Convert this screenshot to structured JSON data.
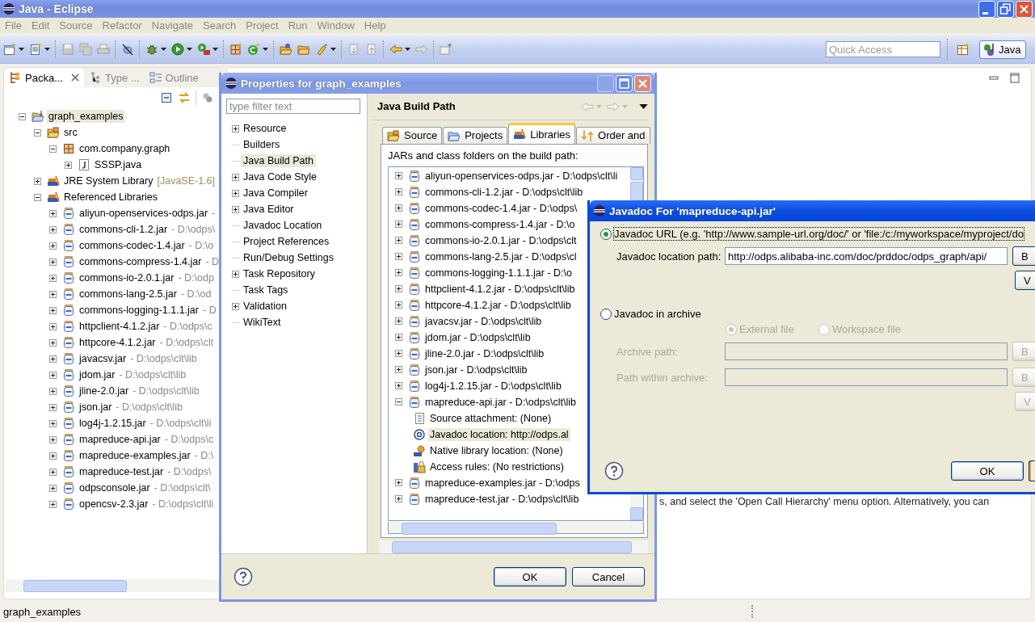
{
  "window": {
    "title": "Java - Eclipse"
  },
  "menu": [
    "File",
    "Edit",
    "Source",
    "Refactor",
    "Navigate",
    "Search",
    "Project",
    "Run",
    "Window",
    "Help"
  ],
  "quick_access": {
    "placeholder": "Quick Access"
  },
  "perspective": {
    "label": "Java",
    "selected": true
  },
  "view_tabs": [
    {
      "label": "Packa...",
      "selected": true
    },
    {
      "label": "Type ...",
      "selected": false
    },
    {
      "label": "Outline",
      "selected": false
    }
  ],
  "package_tree": [
    {
      "label": "graph_examples",
      "kind": "project",
      "expanded": true,
      "selected": true,
      "children": [
        {
          "label": "src",
          "kind": "source-folder",
          "expanded": true,
          "selected": false,
          "children": [
            {
              "label": "com.company.graph",
              "kind": "package",
              "expanded": true,
              "selected": false,
              "children": [
                {
                  "label": "SSSP.java",
                  "kind": "java-file",
                  "expanded": false,
                  "selected": false
                }
              ]
            }
          ]
        },
        {
          "label": "JRE System Library",
          "decoration": "[JavaSE-1.6]",
          "kind": "library",
          "expanded": false,
          "selected": false
        },
        {
          "label": "Referenced Libraries",
          "kind": "library",
          "expanded": true,
          "selected": false,
          "children": [
            {
              "label": "aliyun-openservices-odps.jar",
              "decoration": "-",
              "kind": "jar",
              "expanded": false,
              "selected": false
            },
            {
              "label": "commons-cli-1.2.jar",
              "decoration": "- D:\\odps\\",
              "kind": "jar",
              "expanded": false,
              "selected": false
            },
            {
              "label": "commons-codec-1.4.jar",
              "decoration": "- D:\\o",
              "kind": "jar",
              "expanded": false,
              "selected": false
            },
            {
              "label": "commons-compress-1.4.jar",
              "decoration": "- D",
              "kind": "jar",
              "expanded": false,
              "selected": false
            },
            {
              "label": "commons-io-2.0.1.jar",
              "decoration": "- D:\\odp",
              "kind": "jar",
              "expanded": false,
              "selected": false
            },
            {
              "label": "commons-lang-2.5.jar",
              "decoration": "- D:\\od",
              "kind": "jar",
              "expanded": false,
              "selected": false
            },
            {
              "label": "commons-logging-1.1.1.jar",
              "decoration": "- D",
              "kind": "jar",
              "expanded": false,
              "selected": false
            },
            {
              "label": "httpclient-4.1.2.jar",
              "decoration": "- D:\\odps\\c",
              "kind": "jar",
              "expanded": false,
              "selected": false
            },
            {
              "label": "httpcore-4.1.2.jar",
              "decoration": "- D:\\odps\\clt",
              "kind": "jar",
              "expanded": false,
              "selected": false
            },
            {
              "label": "javacsv.jar",
              "decoration": "- D:\\odps\\clt\\lib",
              "kind": "jar",
              "expanded": false,
              "selected": false
            },
            {
              "label": "jdom.jar",
              "decoration": "- D:\\odps\\clt\\lib",
              "kind": "jar",
              "expanded": false,
              "selected": false
            },
            {
              "label": "jline-2.0.jar",
              "decoration": "- D:\\odps\\clt\\lib",
              "kind": "jar",
              "expanded": false,
              "selected": false
            },
            {
              "label": "json.jar",
              "decoration": "- D:\\odps\\clt\\lib",
              "kind": "jar",
              "expanded": false,
              "selected": false
            },
            {
              "label": "log4j-1.2.15.jar",
              "decoration": "- D:\\odps\\clt\\li",
              "kind": "jar",
              "expanded": false,
              "selected": false
            },
            {
              "label": "mapreduce-api.jar",
              "decoration": "- D:\\odps\\c",
              "kind": "jar",
              "expanded": false,
              "selected": false
            },
            {
              "label": "mapreduce-examples.jar",
              "decoration": "- D:\\",
              "kind": "jar",
              "expanded": false,
              "selected": false
            },
            {
              "label": "mapreduce-test.jar",
              "decoration": "- D:\\odps\\",
              "kind": "jar",
              "expanded": false,
              "selected": false
            },
            {
              "label": "odpsconsole.jar",
              "decoration": "- D:\\odps\\clt\\",
              "kind": "jar",
              "expanded": false,
              "selected": false
            },
            {
              "label": "opencsv-2.3.jar",
              "decoration": "- D:\\odps\\clt\\li",
              "kind": "jar",
              "expanded": false,
              "selected": false
            }
          ]
        }
      ]
    }
  ],
  "editor": {
    "text": "s, and select the 'Open Call Hierarchy' menu option. Alternatively, you can"
  },
  "status_bar": {
    "text": "graph_examples"
  },
  "properties_dialog": {
    "title": "Properties for graph_examples",
    "filter": {
      "placeholder": "type filter text"
    },
    "categories": [
      {
        "label": "Resource",
        "expandable": true,
        "selected": false
      },
      {
        "label": "Builders",
        "expandable": false,
        "selected": false
      },
      {
        "label": "Java Build Path",
        "expandable": false,
        "selected": true
      },
      {
        "label": "Java Code Style",
        "expandable": true,
        "selected": false
      },
      {
        "label": "Java Compiler",
        "expandable": true,
        "selected": false
      },
      {
        "label": "Java Editor",
        "expandable": true,
        "selected": false
      },
      {
        "label": "Javadoc Location",
        "expandable": false,
        "selected": false
      },
      {
        "label": "Project References",
        "expandable": false,
        "selected": false
      },
      {
        "label": "Run/Debug Settings",
        "expandable": false,
        "selected": false
      },
      {
        "label": "Task Repository",
        "expandable": true,
        "selected": false
      },
      {
        "label": "Task Tags",
        "expandable": false,
        "selected": false
      },
      {
        "label": "Validation",
        "expandable": true,
        "selected": false
      },
      {
        "label": "WikiText",
        "expandable": false,
        "selected": false
      }
    ],
    "page_title": "Java Build Path",
    "tabs": [
      {
        "label": "Source",
        "kind": "source",
        "selected": false
      },
      {
        "label": "Projects",
        "kind": "projects",
        "selected": false
      },
      {
        "label": "Libraries",
        "kind": "libraries",
        "selected": true
      },
      {
        "label": "Order and",
        "kind": "order",
        "selected": false
      }
    ],
    "list_caption": "JARs and class folders on the build path:",
    "libraries": [
      {
        "name": "aliyun-openservices-odps.jar - D:\\odps\\clt\\li",
        "expanded": false,
        "selected": false
      },
      {
        "name": "commons-cli-1.2.jar - D:\\odps\\clt\\lib",
        "expanded": false,
        "selected": false
      },
      {
        "name": "commons-codec-1.4.jar - D:\\odps\\",
        "expanded": false,
        "selected": false
      },
      {
        "name": "commons-compress-1.4.jar - D:\\o",
        "expanded": false,
        "selected": false
      },
      {
        "name": "commons-io-2.0.1.jar - D:\\odps\\clt",
        "expanded": false,
        "selected": false
      },
      {
        "name": "commons-lang-2.5.jar - D:\\odps\\cl",
        "expanded": false,
        "selected": false
      },
      {
        "name": "commons-logging-1.1.1.jar - D:\\o",
        "expanded": false,
        "selected": false
      },
      {
        "name": "httpclient-4.1.2.jar - D:\\odps\\clt\\lib",
        "expanded": false,
        "selected": false
      },
      {
        "name": "httpcore-4.1.2.jar - D:\\odps\\clt\\lib",
        "expanded": false,
        "selected": false
      },
      {
        "name": "javacsv.jar - D:\\odps\\clt\\lib",
        "expanded": false,
        "selected": false
      },
      {
        "name": "jdom.jar - D:\\odps\\clt\\lib",
        "expanded": false,
        "selected": false
      },
      {
        "name": "jline-2.0.jar - D:\\odps\\clt\\lib",
        "expanded": false,
        "selected": false
      },
      {
        "name": "json.jar - D:\\odps\\clt\\lib",
        "expanded": false,
        "selected": false
      },
      {
        "name": "log4j-1.2.15.jar - D:\\odps\\clt\\lib",
        "expanded": false,
        "selected": false
      },
      {
        "name": "mapreduce-api.jar - D:\\odps\\clt\\lib",
        "expanded": true,
        "selected": false,
        "children": [
          {
            "label": "Source attachment: (None)",
            "kind": "source",
            "selected": false
          },
          {
            "label": "Javadoc location: http://odps.al",
            "kind": "javadoc",
            "selected": true
          },
          {
            "label": "Native library location: (None)",
            "kind": "native",
            "selected": false
          },
          {
            "label": "Access rules: (No restrictions)",
            "kind": "access",
            "selected": false
          }
        ]
      },
      {
        "name": "mapreduce-examples.jar - D:\\odps",
        "expanded": false,
        "selected": false
      },
      {
        "name": "mapreduce-test.jar - D:\\odps\\clt\\lib",
        "expanded": false,
        "selected": false
      }
    ],
    "buttons": [
      {
        "label": "OK",
        "default": true
      },
      {
        "label": "Cancel",
        "default": false
      }
    ]
  },
  "javadoc_dialog": {
    "title": "Javadoc For 'mapreduce-api.jar'",
    "url_option": {
      "label": "Javadoc URL (e.g. 'http://www.sample-url.org/doc/' or 'file:/c:/myworkspace/myproject/do",
      "selected": true
    },
    "location_label": "Javadoc location path:",
    "location_value": "http://odps.alibaba-inc.com/doc/prddoc/odps_graph/api/",
    "url_buttons": [
      {
        "label": "B",
        "disabled": false
      },
      {
        "label": "V",
        "disabled": false
      }
    ],
    "archive_option": {
      "label": "Javadoc in archive",
      "selected": false
    },
    "archive_kinds": [
      {
        "label": "External file",
        "selected": true,
        "disabled": true
      },
      {
        "label": "Workspace file",
        "selected": false,
        "disabled": true
      }
    ],
    "archive_fields": [
      {
        "label": "Archive path:",
        "disabled": true,
        "button": "B"
      },
      {
        "label": "Path within archive:",
        "disabled": true,
        "button": "B"
      }
    ],
    "archive_validate": {
      "label": "V",
      "disabled": true
    },
    "ok": {
      "label": "OK"
    }
  }
}
